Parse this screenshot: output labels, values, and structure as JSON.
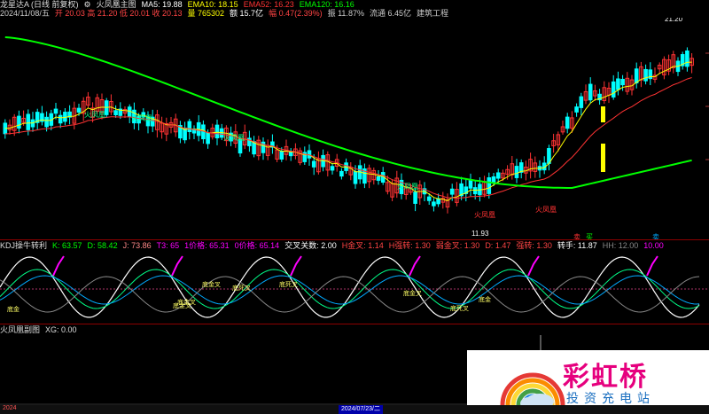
{
  "main_header": {
    "row1": [
      {
        "text": "龙星达A (日线 前复权)",
        "color": "#dddddd"
      },
      {
        "text": "⚙",
        "color": "#dddddd"
      },
      {
        "text": "火凤凰主图",
        "color": "#dddddd"
      },
      {
        "text": "MA5: 19.88",
        "color": "#ffffff"
      },
      {
        "text": "EMA10: 18.15",
        "color": "#ffff00"
      },
      {
        "text": "EMA52: 16.23",
        "color": "#ff3333"
      },
      {
        "text": "EMA120: 16.16",
        "color": "#00ff00"
      }
    ],
    "row2": [
      {
        "text": "2024/11/08/五",
        "color": "#cccccc"
      },
      {
        "text": "开 20.03 高 21.20 低 20.01 收 20.13",
        "color": "#ff4444"
      },
      {
        "text": "量 765302",
        "color": "#ffff00"
      },
      {
        "text": "额 15.7亿",
        "color": "#ffffff"
      },
      {
        "text": "幅 0.47(2.39%)",
        "color": "#ff4444"
      },
      {
        "text": "振 11.87%",
        "color": "#cccccc"
      },
      {
        "text": "流通 6.45亿",
        "color": "#cccccc"
      },
      {
        "text": "建筑工程",
        "color": "#cccccc"
      }
    ]
  },
  "main_labels": {
    "high": "21.20",
    "low": "11.93"
  },
  "main_annotations": [
    {
      "text": "火凤凰",
      "color": "#00ff88"
    },
    {
      "text": "火凤凰",
      "color": "#00ff88"
    },
    {
      "text": "火凤凰",
      "color": "#00ff88"
    },
    {
      "text": "火凤凰",
      "color": "#00ff88"
    },
    {
      "text": "火凤凰",
      "color": "#ff3333"
    },
    {
      "text": "火凤凰",
      "color": "#ff3333"
    }
  ],
  "bottom_markers": [
    {
      "text": "卖",
      "color": "#ff3333"
    },
    {
      "text": "买",
      "color": "#00ff00"
    },
    {
      "text": "卖",
      "color": "#00aaff"
    }
  ],
  "kdj_header": [
    {
      "text": "KDJ操牛转利",
      "color": "#dddddd"
    },
    {
      "text": "K: 63.57",
      "color": "#00ff00"
    },
    {
      "text": "D: 58.42",
      "color": "#00ff00"
    },
    {
      "text": "J: 73.86",
      "color": "#ff8888"
    },
    {
      "text": "T3: 65",
      "color": "#ff00ff"
    },
    {
      "text": "1价格: 65.31",
      "color": "#ff00ff"
    },
    {
      "text": "0价格: 65.14",
      "color": "#ff00ff"
    },
    {
      "text": "交叉关数: 2.00",
      "color": "#ffffff"
    },
    {
      "text": "H金叉: 1.14",
      "color": "#ff4444"
    },
    {
      "text": "H强转: 1.30",
      "color": "#ff4444"
    },
    {
      "text": "弱金叉: 1.30",
      "color": "#ff4444"
    },
    {
      "text": "D: 1.47",
      "color": "#ff4444"
    },
    {
      "text": "强转: 1.30",
      "color": "#ff4444"
    },
    {
      "text": "转手: 11.87",
      "color": "#ffffff"
    },
    {
      "text": "HH: 12.00",
      "color": "#888888"
    },
    {
      "text": "10.00",
      "color": "#ff00ff"
    }
  ],
  "kdj_labels": [
    {
      "text": "底金",
      "color": "#ffff66"
    },
    {
      "text": "底金叉",
      "color": "#ffff66"
    },
    {
      "text": "底金叉",
      "color": "#ffff66"
    },
    {
      "text": "底死叉",
      "color": "#ffff66"
    },
    {
      "text": "底死叉",
      "color": "#ffff66"
    },
    {
      "text": "底金叉",
      "color": "#ffff66"
    },
    {
      "text": "底死叉",
      "color": "#ffff66"
    },
    {
      "text": "底金",
      "color": "#ffff66"
    },
    {
      "text": "底金叉",
      "color": "#ffff66"
    }
  ],
  "sub_header": [
    {
      "text": "火凤凰副图",
      "color": "#dddddd"
    },
    {
      "text": "XG: 0.00",
      "color": "#dddddd"
    }
  ],
  "watermark": {
    "title": "彩虹桥",
    "subtitle": "投资充电站"
  },
  "bottom_bar": {
    "left_label": "2024",
    "date_label": "2024/07/23/二"
  },
  "colors": {
    "up": "#ff3333",
    "down": "#00ffff",
    "ma5": "#ffffff",
    "ema10": "#ffff00",
    "ema52": "#ff3333",
    "ema120": "#00ff00"
  }
}
